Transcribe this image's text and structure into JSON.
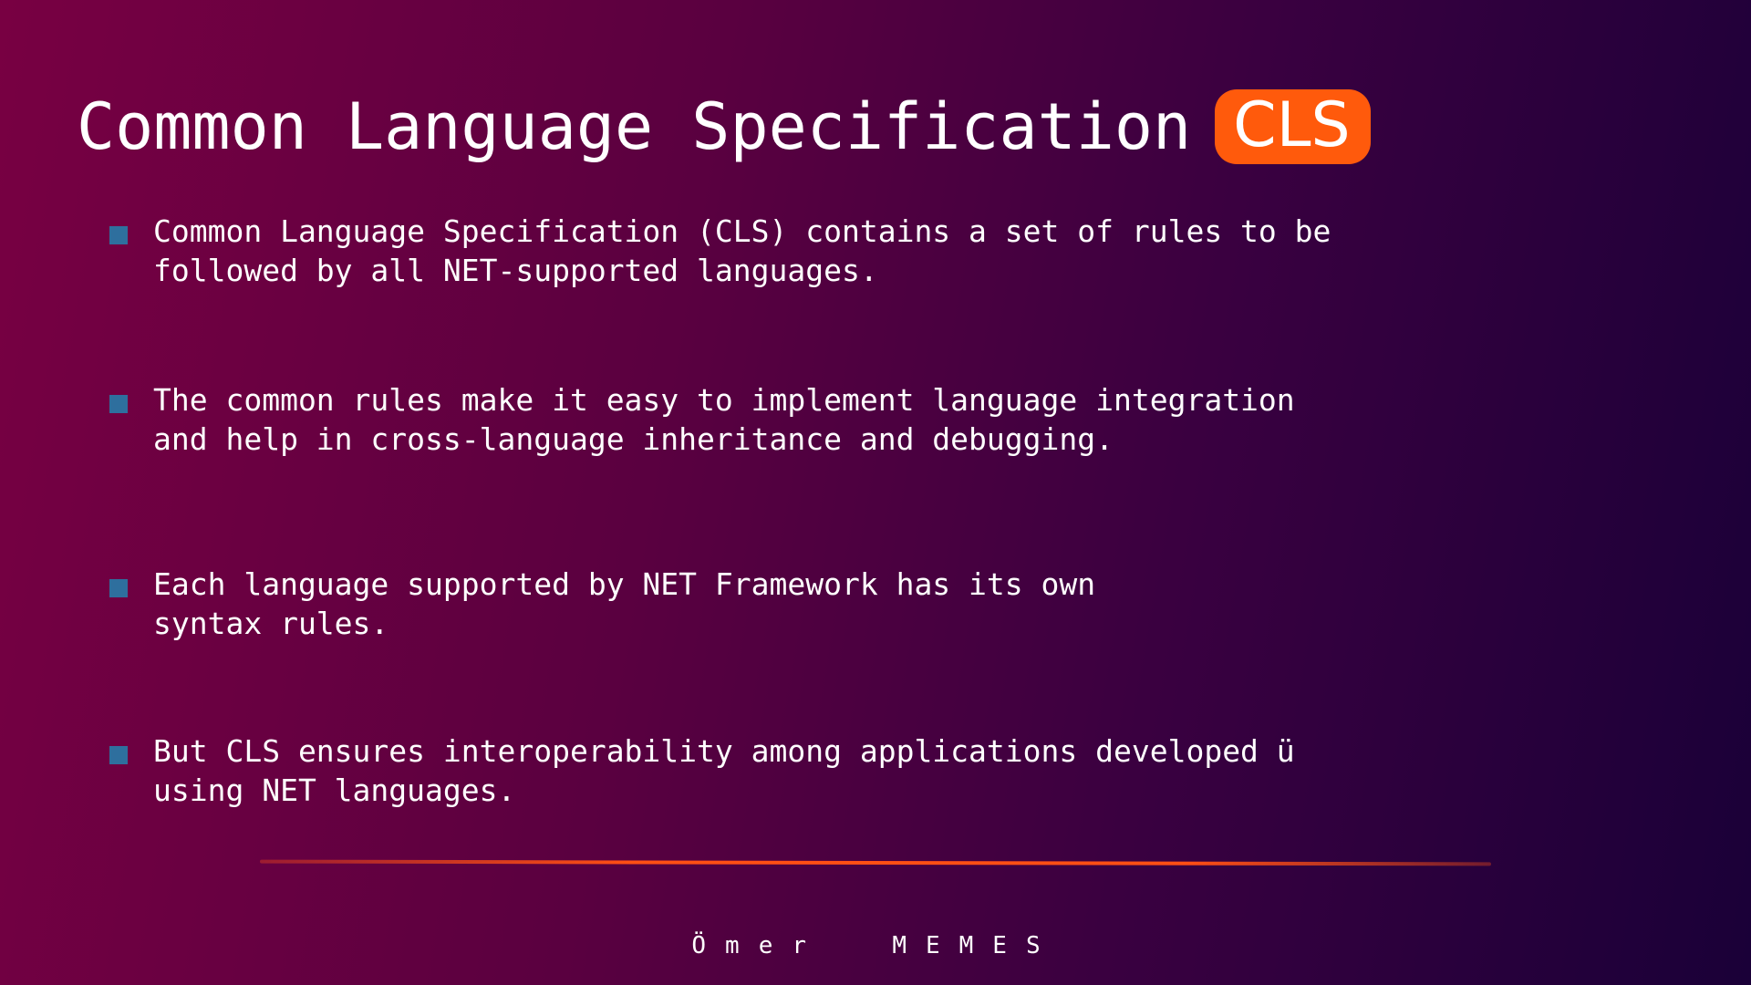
{
  "slide": {
    "title": "Common Language Specification",
    "title_badge": "CLS",
    "bullets": [
      {
        "text": "Common Language Specification (CLS) contains a set of rules to be\nfollowed by all NET-supported languages."
      },
      {
        "text": "The common rules make it easy to implement language integration\nand help in cross-language inheritance and debugging."
      },
      {
        "text": "Each language supported by NET Framework has its own\nsyntax rules."
      },
      {
        "text": "But CLS ensures interoperability among applications developed ü\nusing NET languages."
      }
    ],
    "footer": "Ömer  MEMES"
  },
  "colors": {
    "badge": "#ff5a0c",
    "bullet_marker": "#2e6f9e",
    "divider": "#ff4f14",
    "bg_start": "#780042",
    "bg_end": "#1a0038"
  }
}
